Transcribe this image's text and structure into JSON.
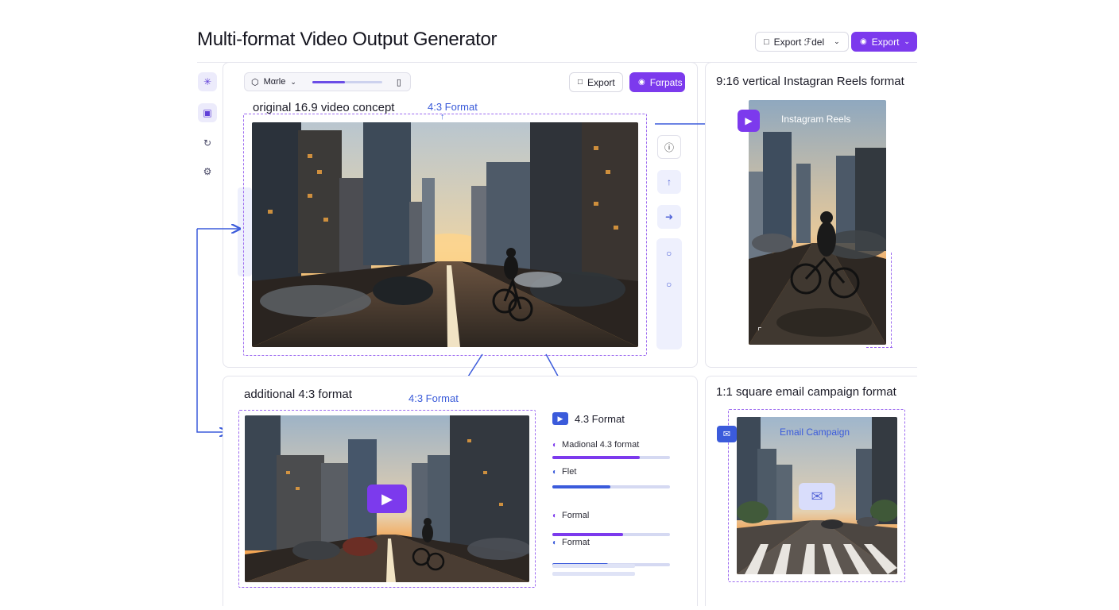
{
  "header": {
    "title": "Multi-format Video Output Generator",
    "export_model_label": "Export ℱdel",
    "export_label": "Export"
  },
  "toolbar": {
    "mode_label": "Mαrle",
    "slider_value": 0.47,
    "export_label": "Export",
    "formats_label": "Fαrpats"
  },
  "main_panel": {
    "label": "original 16.9 video concept",
    "format_annotation": "4:3 Format"
  },
  "reels_panel": {
    "label": "9:16 vertical Instagran Reels format",
    "overlay_text": "Instagram Reels"
  },
  "additional_panel": {
    "label": "additional 4:3 format",
    "format_annotation": "4:3 Format",
    "list_title": "4.3 Format",
    "items": [
      {
        "label": "Madional 4.3 format",
        "progress": 0.74,
        "color": "#7c3aed"
      },
      {
        "label": "Flet",
        "progress": 0.49,
        "color": "#3b5bdb"
      },
      {
        "label": "Formal",
        "progress": 0.6,
        "color": "#7c3aed"
      },
      {
        "label": "Format",
        "progress": 0.47,
        "color": "#3b5bdb"
      }
    ]
  },
  "email_panel": {
    "label": "1:1 square email campaign format",
    "overlay_text": "Email Campaign"
  },
  "colors": {
    "accent": "#7c3aed",
    "blue": "#3b5bdb",
    "dashed": "#9d6bf0"
  }
}
